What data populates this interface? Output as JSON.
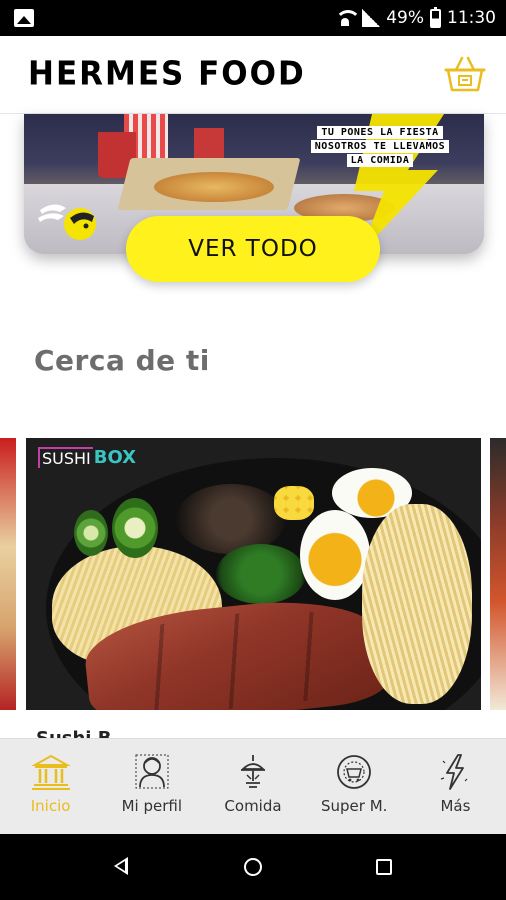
{
  "status_bar": {
    "battery": "49%",
    "time": "11:30"
  },
  "header": {
    "app_name": "HERMES FOOD",
    "cart_icon": "basket-icon"
  },
  "banner": {
    "slogan": [
      "TU PONES LA FIESTA",
      "NOSOTROS TE LLEVAMOS",
      "LA COMIDA"
    ],
    "button_label": "VER TODO",
    "accent_color": "#fff21c"
  },
  "nearby": {
    "title": "Cerca de ti",
    "featured": {
      "brand_part1": "SUSHI",
      "brand_part2": "BOX",
      "label": "Sushi B..."
    }
  },
  "bottom_nav": {
    "items": [
      {
        "label": "Inicio",
        "icon": "temple-icon",
        "active": true
      },
      {
        "label": "Mi perfil",
        "icon": "profile-icon",
        "active": false
      },
      {
        "label": "Comida",
        "icon": "dish-icon",
        "active": false
      },
      {
        "label": "Super M.",
        "icon": "supermarket-icon",
        "active": false
      },
      {
        "label": "Más",
        "icon": "bolt-icon",
        "active": false
      }
    ],
    "active_color": "#e9bd1c"
  }
}
